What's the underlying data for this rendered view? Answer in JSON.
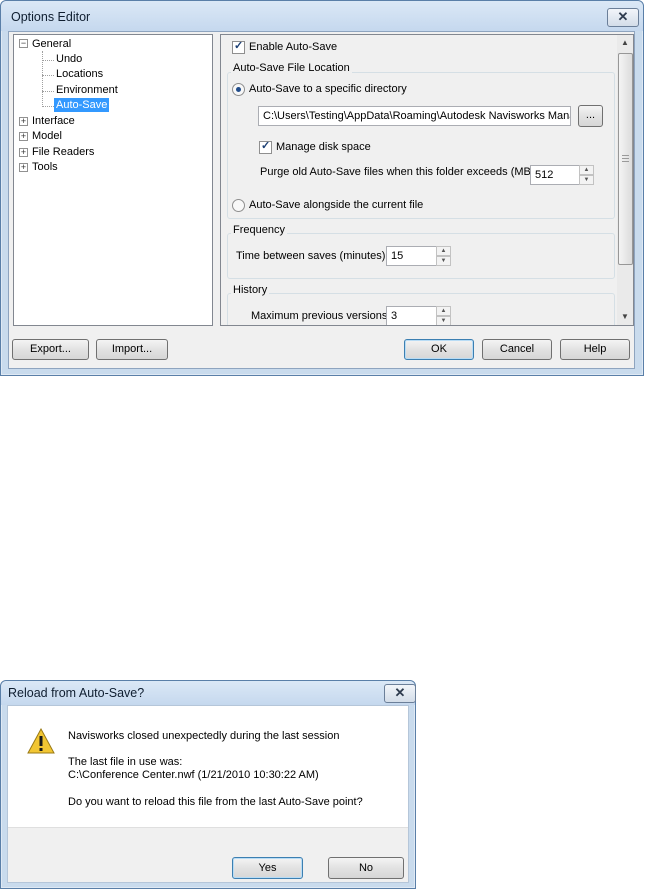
{
  "options_editor": {
    "title": "Options Editor",
    "close_glyph": "✕",
    "tree": {
      "general": "General",
      "undo": "Undo",
      "locations": "Locations",
      "environment": "Environment",
      "auto_save": "Auto-Save",
      "interface": "Interface",
      "model": "Model",
      "file_readers": "File Readers",
      "tools": "Tools"
    },
    "panel": {
      "enable_auto_save": "Enable Auto-Save",
      "location_group": "Auto-Save File Location",
      "specific_directory": "Auto-Save to a specific directory",
      "directory_path": "C:\\Users\\Testing\\AppData\\Roaming\\Autodesk Navisworks Manage",
      "browse_label": "...",
      "manage_disk_space": "Manage disk space",
      "purge_label": "Purge old Auto-Save files when this folder exceeds (MB)",
      "purge_value": "512",
      "alongside_current": "Auto-Save alongside the current file",
      "frequency_group": "Frequency",
      "time_between_label": "Time between saves (minutes)",
      "time_between_value": "15",
      "history_group": "History",
      "max_versions_label": "Maximum previous versions",
      "max_versions_value": "3"
    },
    "buttons": {
      "export": "Export...",
      "import": "Import...",
      "ok": "OK",
      "cancel": "Cancel",
      "help": "Help"
    }
  },
  "reload_dialog": {
    "title": "Reload from Auto-Save?",
    "close_glyph": "✕",
    "line1": "Navisworks closed unexpectedly during the last session",
    "line2": "The last file in use was:",
    "line3": "C:\\Conference Center.nwf (1/21/2010 10:30:22 AM)",
    "line4": "Do you want to reload this file from the last Auto-Save point?",
    "yes": "Yes",
    "no": "No"
  },
  "icons": {
    "warning": "warning-icon",
    "close": "close-icon"
  },
  "colors": {
    "selection": "#3399ff",
    "title_bar": "#c9dbed"
  }
}
